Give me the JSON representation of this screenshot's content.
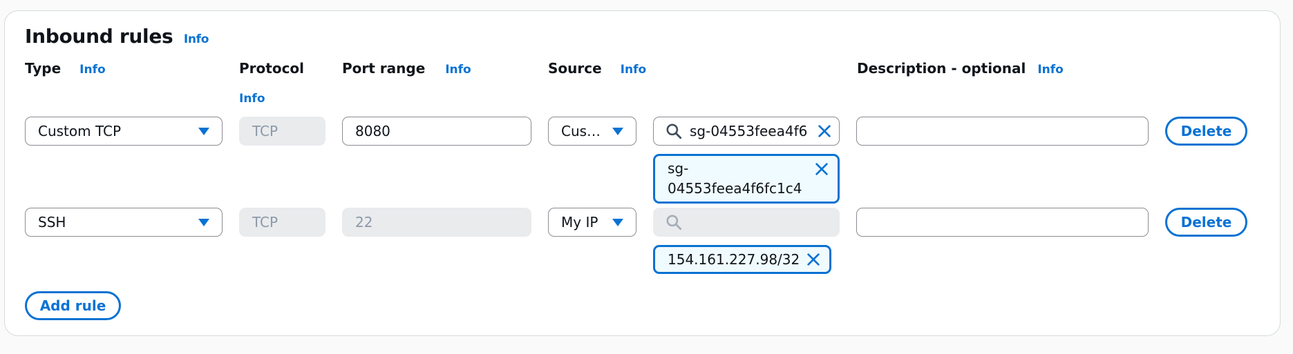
{
  "section": {
    "title": "Inbound rules",
    "info": "Info"
  },
  "headers": {
    "type": "Type",
    "protocol": "Protocol",
    "port_range": "Port range",
    "source": "Source",
    "description": "Description - optional",
    "info": "Info"
  },
  "rules": [
    {
      "type": "Custom TCP",
      "protocol": "TCP",
      "port_range": "8080",
      "source_type": "Cus…",
      "source_search_value": "sg-04553feea4f6",
      "source_token_line1": "sg-",
      "source_token_line2": "04553feea4f6fc1c4",
      "description": "",
      "delete_label": "Delete"
    },
    {
      "type": "SSH",
      "protocol": "TCP",
      "port_range": "22",
      "source_type": "My IP",
      "source_search_value": "",
      "source_token": "154.161.227.98/32",
      "description": "",
      "delete_label": "Delete"
    }
  ],
  "add_rule_label": "Add rule",
  "colors": {
    "accent": "#0972d3",
    "token_bg": "#f0fbff",
    "disabled_bg": "#e9ebed"
  }
}
